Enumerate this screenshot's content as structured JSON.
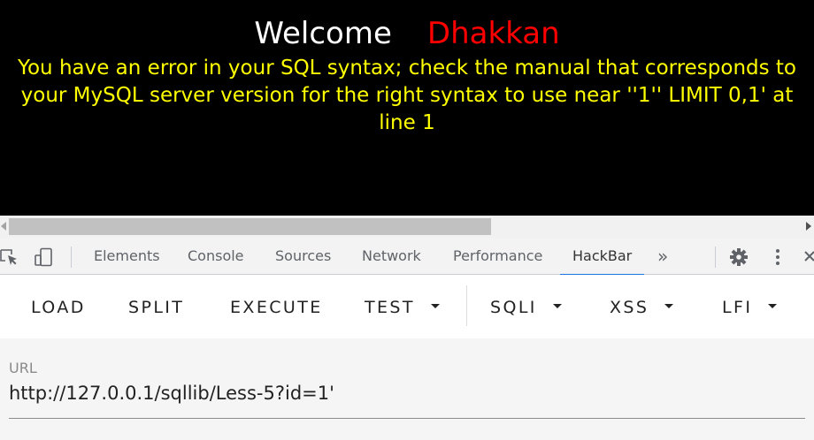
{
  "page": {
    "welcome": "Welcome",
    "name": "Dhakkan",
    "error_line1": "You have an error in your SQL syntax; check the manual that corresponds to",
    "error_line2": "your MySQL server version for the right syntax to use near ''1'' LIMIT 0,1' at",
    "error_line3": "line 1"
  },
  "devtools": {
    "tabs": [
      "Elements",
      "Console",
      "Sources",
      "Network",
      "Performance",
      "HackBar"
    ],
    "active_tab": "HackBar",
    "more_label": "»",
    "icons": [
      "inspect-icon",
      "device-toolbar-icon",
      "gear-icon",
      "kebab-menu-icon",
      "close-icon"
    ]
  },
  "hackbar": {
    "buttons": {
      "load": "LOAD",
      "split": "SPLIT",
      "execute": "EXECUTE",
      "test": "TEST",
      "sqli": "SQLI",
      "xss": "XSS",
      "lfi": "LFI"
    },
    "url_label": "URL",
    "url_value": "http://127.0.0.1/sqllib/Less-5?id=1'"
  },
  "colors": {
    "page_bg": "#000000",
    "welcome": "#ffffff",
    "name": "#ff0000",
    "error_text": "#ffff00",
    "active_tab_underline": "#1a73e8"
  }
}
